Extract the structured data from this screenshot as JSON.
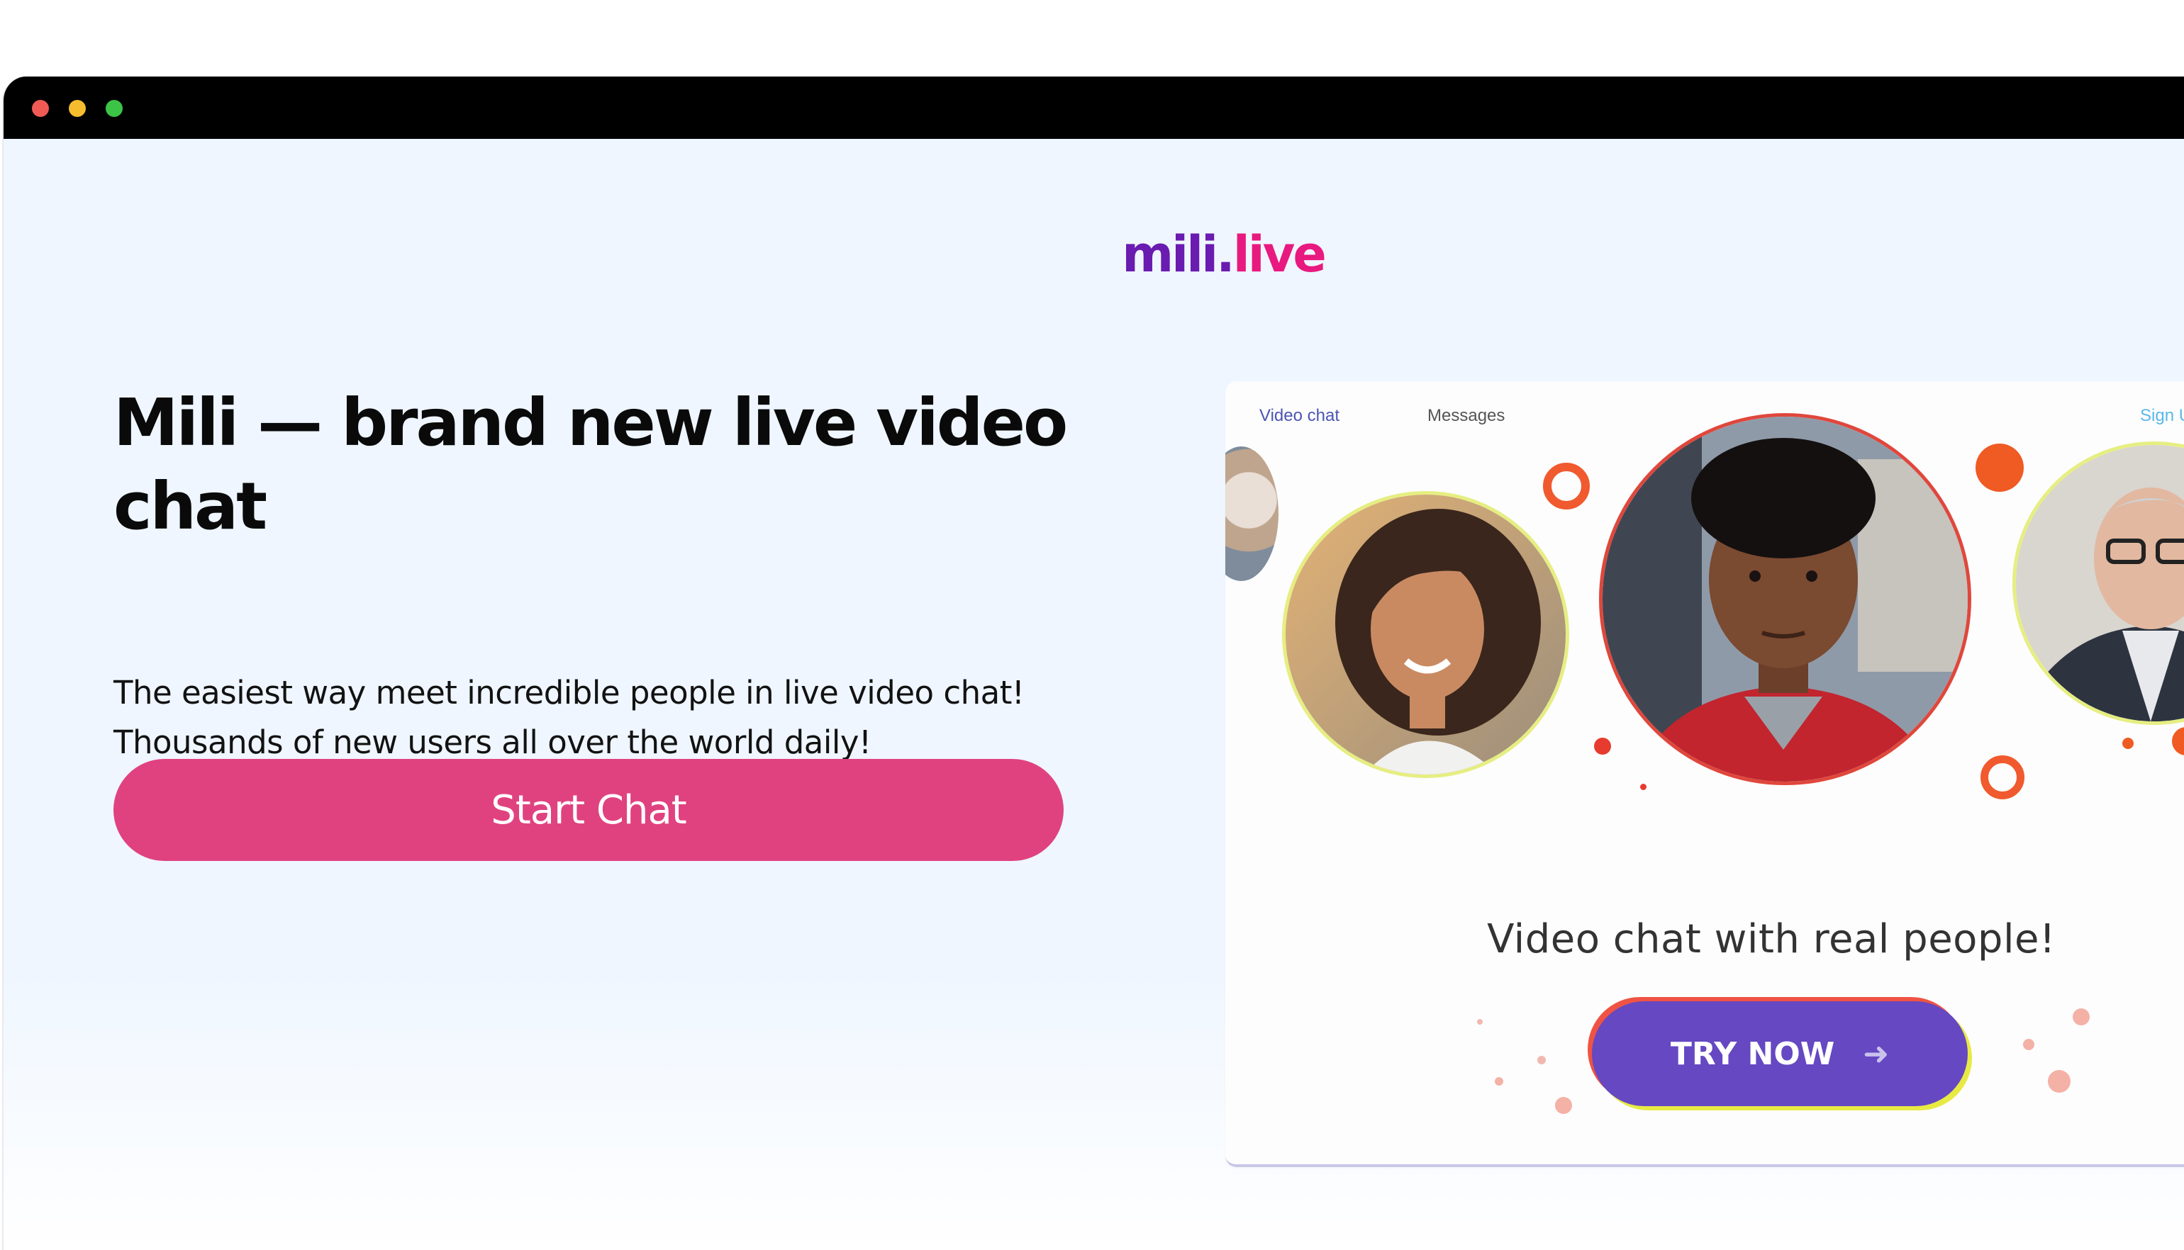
{
  "window": {
    "controls": [
      "close",
      "minimize",
      "maximize"
    ]
  },
  "brand": {
    "logo_part1": "mili.",
    "logo_part2": "live",
    "colors": {
      "purple": "#6a1bb0",
      "pink": "#e8197f"
    }
  },
  "hero": {
    "headline": "Mili — brand new live video chat",
    "subtext_line1": "The easiest way meet incredible people in live video chat!",
    "subtext_line2": "Thousands of new users all over the world daily!",
    "cta_label": "Start Chat",
    "cta_color": "#e04280"
  },
  "preview": {
    "nav": {
      "video_chat": "Video chat",
      "messages": "Messages",
      "sign_up": "Sign U"
    },
    "caption": "Video chat with real people!",
    "try_label": "TRY NOW",
    "try_icon": "arrow-right-icon",
    "try_color": "#6548c2"
  }
}
